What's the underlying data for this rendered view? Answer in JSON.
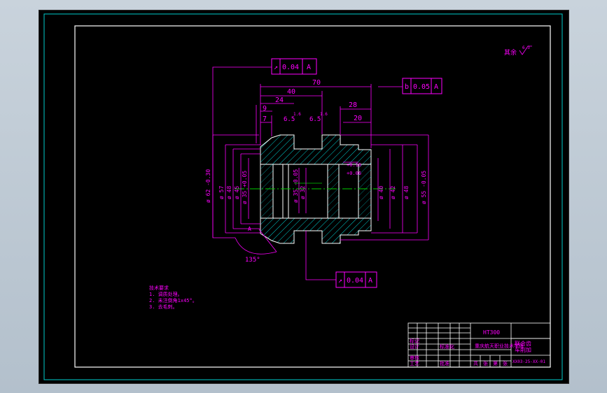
{
  "colors": {
    "background": "#000000",
    "frame": "#ffffff",
    "outer_frame": "#00cccc",
    "dimension": "#ff00ff",
    "hatch": "#00cccc",
    "centerline": "#00cc00",
    "annotation": "#ff00ff"
  },
  "roughness": {
    "label": "其余",
    "value": "6.3"
  },
  "tolerance_frames": {
    "top_a": {
      "symbol": "↗",
      "value": "0.04",
      "datum": "A"
    },
    "top_b": {
      "symbol": "b",
      "value": "0.05",
      "datum": "A"
    },
    "bottom": {
      "symbol": "↗",
      "value": "0.04",
      "datum": "A"
    }
  },
  "dimensions": {
    "horizontal": {
      "d70": "70",
      "d40": "40",
      "d24": "24",
      "d9": "9",
      "d7": "7",
      "d28": "28",
      "d20": "20"
    },
    "roughness_marks": {
      "r1": "6.5",
      "r2": "6.5",
      "r3": "1.6",
      "r4": "1.6",
      "r5": "1.6"
    },
    "vertical": {
      "left1": "ø 62 -0.30",
      "left2": "ø 57",
      "left3": "ø 48",
      "left4": "ø 45",
      "left5": "ø 35 +0.05",
      "mid1": "ø 35 -0.05",
      "mid2": "ø 32",
      "right1": "ø 40",
      "right2": "ø 42",
      "right3": "ø 48",
      "right4": "ø 55 -0.05"
    },
    "bore_tol": {
      "top": "+0.16",
      "bottom": "+0.06"
    },
    "angle": "135°",
    "datum_letter": "A"
  },
  "technical_notes": {
    "heading": "技术要求",
    "lines": [
      "1. 调质处理。",
      "2. 未注倒角1x45°。",
      "3. 去毛刺。"
    ]
  },
  "title_block": {
    "material": "HT300",
    "part_name_1": "联合齿",
    "part_name_2": "车削加",
    "school": "重庆航天职业技术学院",
    "drawing_no": "XX03-25-XX-01",
    "row_labels": [
      "标记",
      "设计",
      "审核",
      "工艺"
    ],
    "bottom_labels": [
      "共",
      "张",
      "第",
      "张"
    ],
    "std_label": "标准化",
    "approve_label": "批准"
  }
}
